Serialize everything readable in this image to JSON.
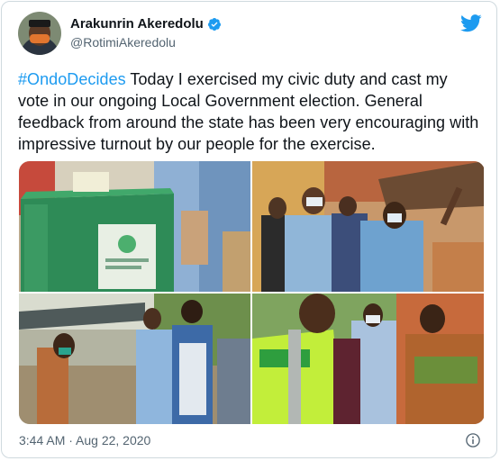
{
  "author": {
    "display_name": "Arakunrin Akeredolu",
    "handle": "@RotimiAkeredolu"
  },
  "tweet": {
    "hashtag": "#OndoDecides",
    "body": " Today I exercised my civic duty and cast my vote in our ongoing Local Government election. General feedback from around the state has been very encouraging with impressive turnout by our people for the exercise."
  },
  "photos": [
    {
      "label": "ballot-box-photo"
    },
    {
      "label": "crowd-photo"
    },
    {
      "label": "walking-photo"
    },
    {
      "label": "officials-photo"
    }
  ],
  "meta": {
    "timestamp": "3:44 AM · Aug 22, 2020"
  },
  "colors": {
    "accent": "#1d9bf0",
    "text": "#0f1419",
    "secondary": "#536471"
  },
  "icons": {
    "verified": "verified-badge-icon",
    "brand": "twitter-bird-icon",
    "info": "info-icon"
  }
}
